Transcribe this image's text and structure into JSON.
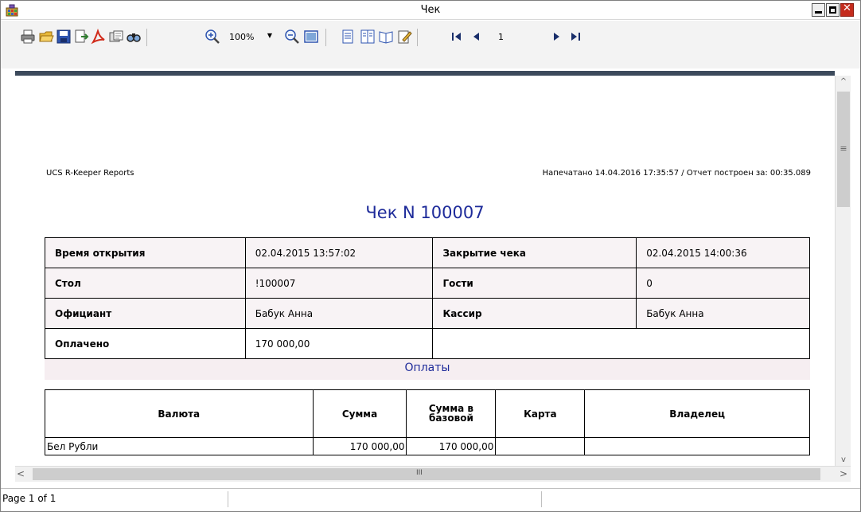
{
  "window": {
    "title": "Чек",
    "minimize_icon": "minimize-icon",
    "maximize_icon": "maximize-icon",
    "close_icon": "close-icon"
  },
  "toolbar": {
    "buttons": [
      "print-icon",
      "open-icon",
      "save-icon",
      "export-icon",
      "pdf-icon",
      "send-icon",
      "find-icon",
      "zoom-in-icon",
      "zoom-out-icon",
      "full-page-icon",
      "single-page-icon",
      "two-pages-icon",
      "book-icon",
      "edit-icon",
      "first-page-icon",
      "prev-page-icon",
      "next-page-icon",
      "last-page-icon"
    ],
    "zoom_value": "100%",
    "page_value": "1"
  },
  "report": {
    "source": "UCS R-Keeper Reports",
    "printed": "Напечатано 14.04.2016  17:35:57 / Отчет построен за: 00:35.089",
    "title": "Чек N 100007",
    "info": {
      "open_time_label": "Время открытия",
      "open_time_value": "02.04.2015 13:57:02",
      "close_label": "Закрытие чека",
      "close_value": "02.04.2015 14:00:36",
      "table_label": "Стол",
      "table_value": "!100007",
      "guests_label": "Гости",
      "guests_value": "0",
      "waiter_label": "Официант",
      "waiter_value": "Бабук Анна",
      "cashier_label": "Кассир",
      "cashier_value": "Бабук Анна",
      "paid_label": "Оплачено",
      "paid_value": "170 000,00"
    },
    "payments_title": "Оплаты",
    "payments": {
      "headers": [
        "Валюта",
        "Сумма",
        "Сумма в базовой",
        "Карта",
        "Владелец"
      ],
      "rows": [
        [
          "Бел Рубли",
          "170 000,00",
          "170 000,00",
          "",
          ""
        ]
      ]
    }
  },
  "statusbar": {
    "page_info": "Page 1 of 1"
  },
  "colors": {
    "title_blue": "#1e2b9a",
    "header_band": "#3c4a5c",
    "row_tint": "#f8f3f5"
  }
}
